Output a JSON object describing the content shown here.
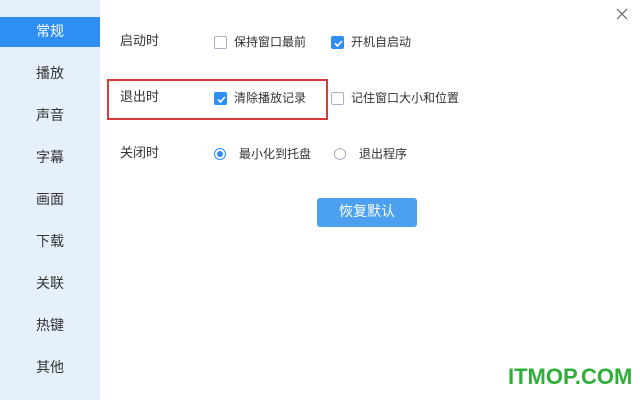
{
  "sidebar": {
    "items": [
      {
        "label": "常规",
        "active": true
      },
      {
        "label": "播放",
        "active": false
      },
      {
        "label": "声音",
        "active": false
      },
      {
        "label": "字幕",
        "active": false
      },
      {
        "label": "画面",
        "active": false
      },
      {
        "label": "下载",
        "active": false
      },
      {
        "label": "关联",
        "active": false
      },
      {
        "label": "热键",
        "active": false
      },
      {
        "label": "其他",
        "active": false
      }
    ]
  },
  "settings": {
    "startup": {
      "label": "启动时",
      "options": [
        {
          "label": "保持窗口最前",
          "checked": false
        },
        {
          "label": "开机自启动",
          "checked": true
        }
      ]
    },
    "exit": {
      "label": "退出时",
      "options": [
        {
          "label": "清除播放记录",
          "checked": true
        },
        {
          "label": "记住窗口大小和位置",
          "checked": false
        }
      ]
    },
    "close": {
      "label": "关闭时",
      "options": [
        {
          "label": "最小化到托盘",
          "selected": true
        },
        {
          "label": "退出程序",
          "selected": false
        }
      ]
    }
  },
  "buttons": {
    "restore_defaults": "恢复默认"
  },
  "watermark": "ITMOP.COM",
  "colors": {
    "accent": "#2e8ef2",
    "sidebar_bg": "#e6f0fc",
    "highlight_border": "#d9393b",
    "watermark": "#2fae3a"
  }
}
